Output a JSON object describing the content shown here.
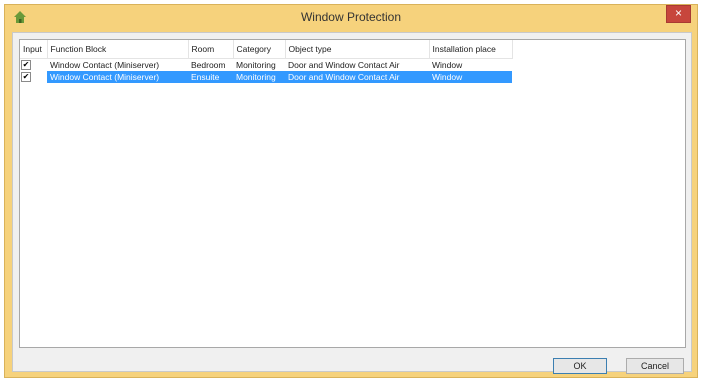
{
  "window": {
    "title": "Window Protection",
    "close_glyph": "×",
    "app_icon": "home-icon"
  },
  "table": {
    "columns": [
      "Input",
      "Function Block",
      "Room",
      "Category",
      "Object type",
      "Installation place"
    ],
    "rows": [
      {
        "checked": "✔",
        "function_block": "Window Contact (Miniserver)",
        "room": "Bedroom",
        "category": "Monitoring",
        "object_type": "Door and Window Contact Air",
        "installation_place": "Window"
      },
      {
        "checked": "✔",
        "function_block": "Window Contact (Miniserver)",
        "room": "Ensuite",
        "category": "Monitoring",
        "object_type": "Door and Window Contact Air",
        "installation_place": "Window"
      }
    ]
  },
  "buttons": {
    "ok": "OK",
    "cancel": "Cancel"
  },
  "colors": {
    "frame": "#f6d27c",
    "selection": "#3399ff",
    "close": "#c7463c"
  }
}
